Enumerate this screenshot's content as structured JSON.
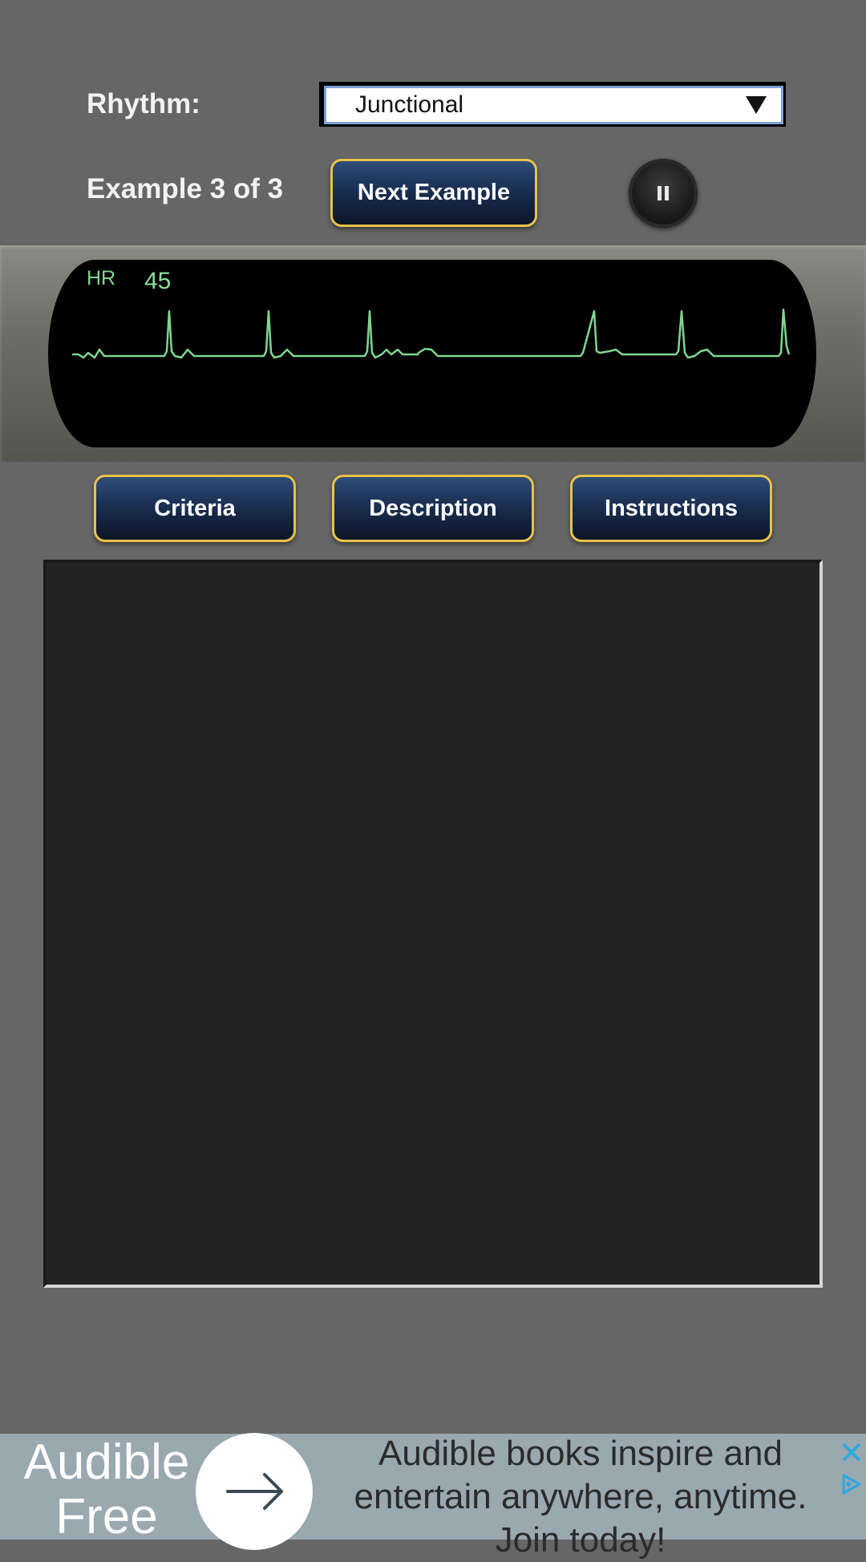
{
  "rhythm": {
    "label": "Rhythm:",
    "selected": "Junctional"
  },
  "example": {
    "counter": "Example 3 of 3",
    "next_label": "Next Example"
  },
  "monitor": {
    "hr_label": "HR",
    "hr_value": "45",
    "trace_color": "#7fd68f"
  },
  "info_buttons": {
    "criteria": "Criteria",
    "description": "Description",
    "instructions": "Instructions"
  },
  "ad": {
    "brand": "Audible Free",
    "text": "Audible books inspire and entertain anywhere, anytime. Join today!",
    "close_icon": "close-icon",
    "choices_icon": "ad-choices-icon"
  },
  "colors": {
    "background": "#666666",
    "button_border": "#e7c24a",
    "button_fill": "#1a2f52",
    "panel": "#242424"
  }
}
